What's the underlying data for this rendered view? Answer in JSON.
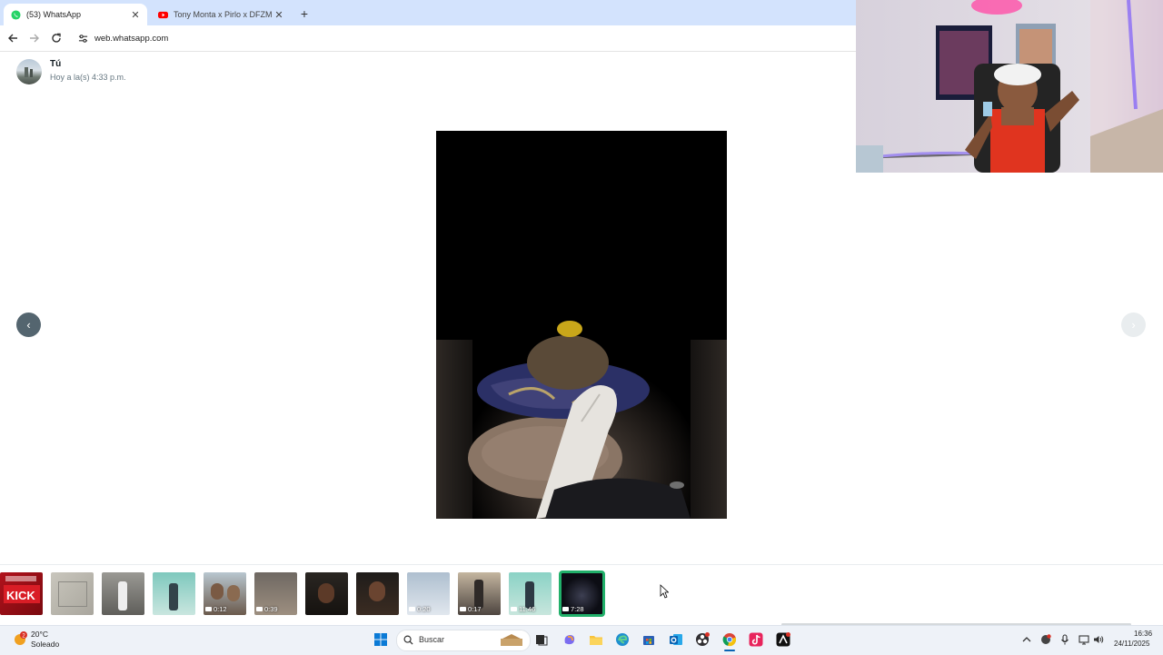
{
  "browser": {
    "tabs": [
      {
        "title": "(53) WhatsApp",
        "icon": "whatsapp-icon",
        "active": true
      },
      {
        "title": "Tony Monta x Pirlo x DFZM x To",
        "icon": "youtube-icon",
        "active": false
      }
    ],
    "url": "web.whatsapp.com"
  },
  "viewer": {
    "sender_name": "Tú",
    "timestamp": "Hoy a la(s) 4:33 p.m.",
    "thumbnails": [
      {
        "duration": ""
      },
      {
        "duration": ""
      },
      {
        "duration": ""
      },
      {
        "duration": ""
      },
      {
        "duration": "0:12"
      },
      {
        "duration": "0:39"
      },
      {
        "duration": ""
      },
      {
        "duration": ""
      },
      {
        "duration": "0:20"
      },
      {
        "duration": "0:17"
      },
      {
        "duration": "11:46"
      },
      {
        "duration": "7:28"
      }
    ],
    "selected_thumbnail": 12,
    "thumb_kick_text": "KICK",
    "accent_color": "#21b06a"
  },
  "taskbar": {
    "weather_temp": "20°C",
    "weather_condition": "Soleado",
    "weather_badge": "2",
    "search_placeholder": "Buscar",
    "clock_time": "16:36",
    "clock_date": "24/11/2025"
  }
}
